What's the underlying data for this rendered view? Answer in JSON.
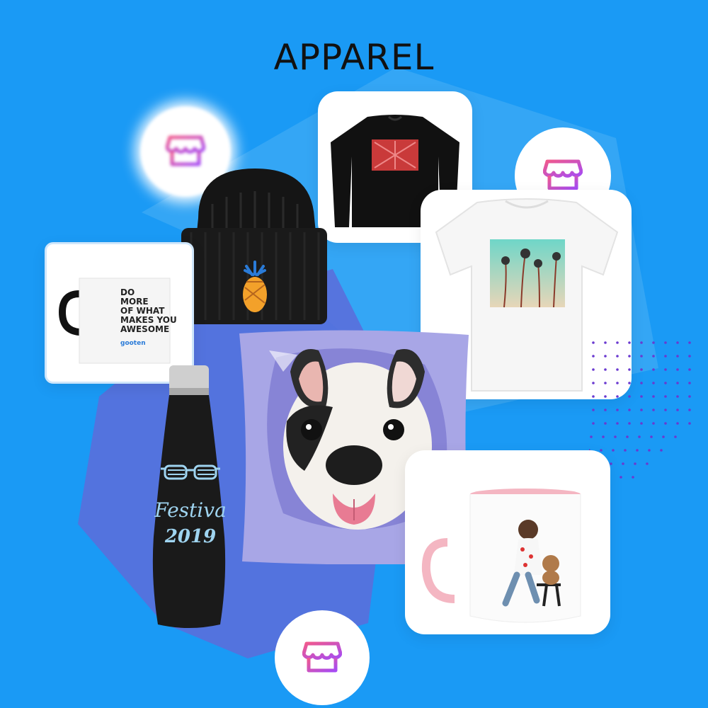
{
  "title": "APPAREL",
  "colors": {
    "background": "#1a9af5",
    "polygon_light": "#3aa8f4",
    "polygon_purple": "#5a6fdc",
    "store_icon_gradient_start": "#f15a8c",
    "store_icon_gradient_end": "#a64bf4",
    "dots": "#6a3ad0"
  },
  "products": {
    "mug": {
      "line1": "DO",
      "line2": "MORE",
      "line3": "OF WHAT",
      "line4": "MAKES YOU",
      "line5": "AWESOME",
      "brand": "gooten"
    },
    "bottle": {
      "line1": "Festiva",
      "line2": "2019"
    }
  },
  "icons": [
    "store-icon",
    "store-icon",
    "store-icon"
  ]
}
